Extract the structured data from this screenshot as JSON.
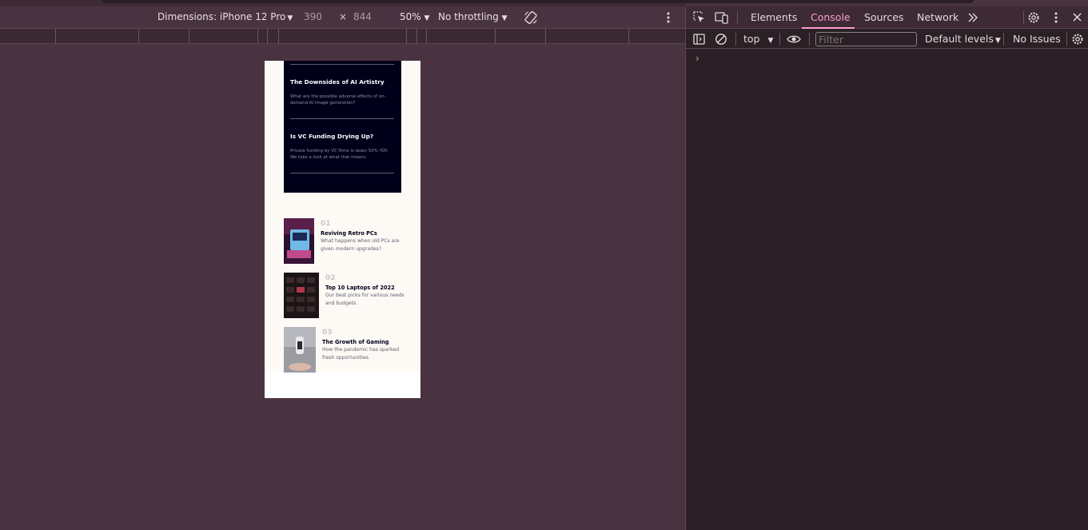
{
  "device_toolbar": {
    "dimensions_label": "Dimensions: iPhone 12 Pro",
    "width": "390",
    "times": "×",
    "height": "844",
    "zoom": "50%",
    "throttling": "No throttling"
  },
  "page": {
    "new_articles": [
      {
        "title": "The Downsides of AI Artistry",
        "desc": "What are the possible adverse effects of on-demand AI image generation?"
      },
      {
        "title": "Is VC Funding Drying Up?",
        "desc": "Private funding by VC firms is down 50% YOY. We take a look at what that means."
      }
    ],
    "ranked": [
      {
        "num": "01",
        "title": "Reviving Retro PCs",
        "desc": "What happens when old PCs are given modern upgrades?"
      },
      {
        "num": "02",
        "title": "Top 10 Laptops of 2022",
        "desc": "Our best picks for various needs and budgets."
      },
      {
        "num": "03",
        "title": "The Growth of Gaming",
        "desc": "How the pandemic has sparked fresh opportunities."
      }
    ]
  },
  "devtools": {
    "tabs": [
      "Elements",
      "Console",
      "Sources",
      "Network"
    ],
    "active_tab": "Console",
    "context": "top",
    "filter_placeholder": "Filter",
    "levels": "Default levels",
    "issues": "No Issues",
    "prompt": "›"
  },
  "colors": {
    "accent": "#ff9ccf",
    "navy": "#00001a",
    "chrome": "#4a3340"
  }
}
